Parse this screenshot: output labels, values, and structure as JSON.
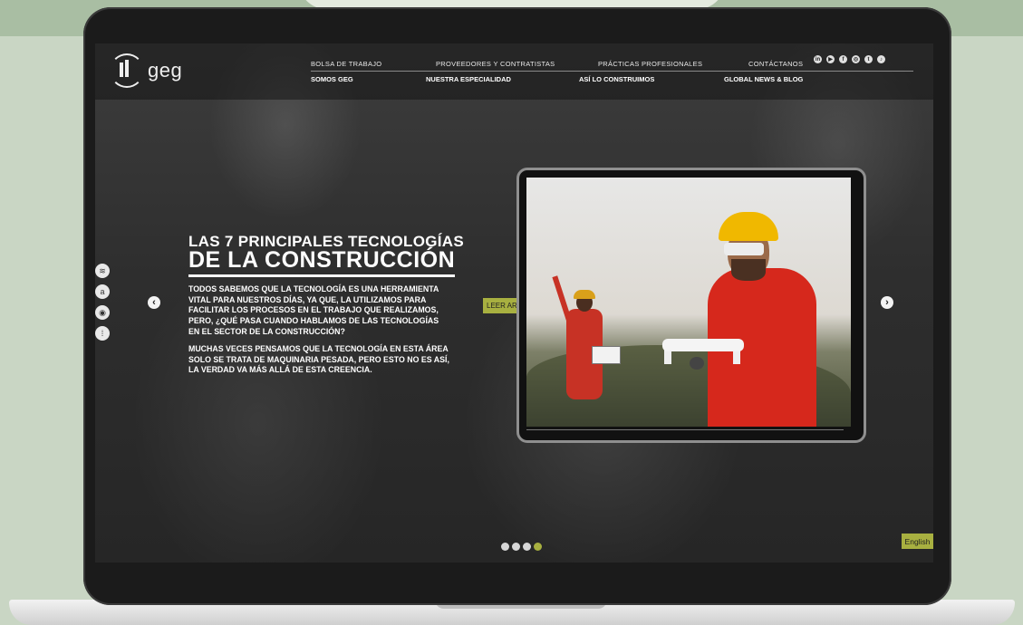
{
  "brand": {
    "logo_text": "geg"
  },
  "nav": {
    "top_items": [
      "BOLSA DE TRABAJO",
      "PROVEEDORES Y CONTRATISTAS",
      "PRÁCTICAS PROFESIONALES",
      "CONTÁCTANOS"
    ],
    "bottom_items": [
      "SOMOS GEG",
      "NUESTRA ESPECIALIDAD",
      "ASÍ LO CONSTRUIMOS",
      "GLOBAL NEWS & BLOG"
    ],
    "social_icons": [
      "linkedin-icon",
      "youtube-icon",
      "facebook-icon",
      "instagram-icon",
      "twitter-icon",
      "tiktok-icon"
    ]
  },
  "hero": {
    "title_line1": "LAS 7 PRINCIPALES TECNOLOGÍAS",
    "title_line2": "DE LA CONSTRUCCIÓN",
    "paragraph1": "TODOS SABEMOS QUE LA TECNOLOGÍA ES UNA HERRAMIENTA VITAL PARA NUESTROS DÍAS, YA QUE, LA UTILIZAMOS PARA FACILITAR LOS PROCESOS EN EL TRABAJO QUE REALIZAMOS, PERO, ¿QUÉ PASA CUANDO HABLAMOS DE LAS TECNOLOGÍAS EN EL SECTOR DE LA CONSTRUCCIÓN?",
    "paragraph2": "MUCHAS VECES PENSAMOS QUE LA TECNOLOGÍA EN ESTA ÁREA SOLO SE TRATA DE MAQUINARIA PESADA, PERO ESTO NO ES ASÍ, LA VERDAD VA MÁS ALLÁ DE ESTA CREENCIA.",
    "cta_label": "LEER ARTÍCULO"
  },
  "podcast_icons": [
    "spotify-icon",
    "amazon-icon",
    "podcasts-icon",
    "google-podcasts-icon"
  ],
  "carousel": {
    "prev_symbol": "‹",
    "next_symbol": "›",
    "slide_count": 4,
    "active_slide": 4
  },
  "language": {
    "label": "English"
  },
  "colors": {
    "accent": "#a8b040",
    "nav_bg": "#141414"
  }
}
